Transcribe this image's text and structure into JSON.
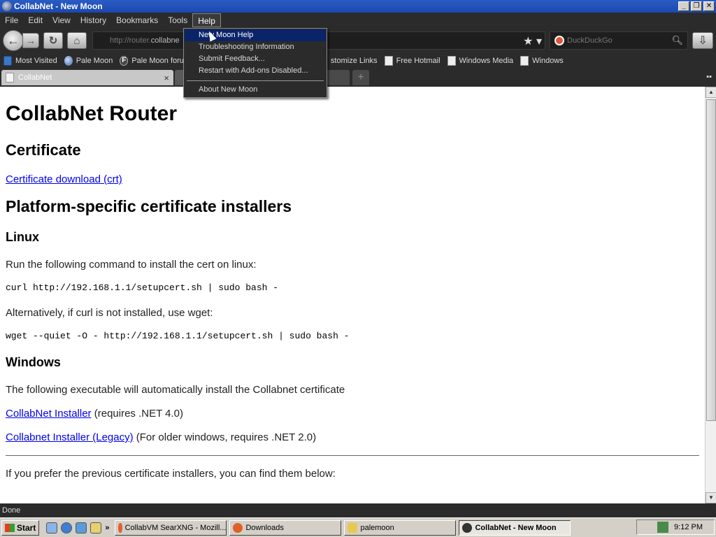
{
  "window": {
    "title": "CollabNet - New Moon"
  },
  "menubar": {
    "items": [
      {
        "label": "File"
      },
      {
        "label": "Edit"
      },
      {
        "label": "View"
      },
      {
        "label": "History"
      },
      {
        "label": "Bookmarks"
      },
      {
        "label": "Tools"
      },
      {
        "label": "Help"
      }
    ]
  },
  "navbar": {
    "url_prefix": "http://router.",
    "url_host": "collabne",
    "search_placeholder": "DuckDuckGo"
  },
  "bookmarks": [
    {
      "label": "Most Visited",
      "icon": "most-visited-icon"
    },
    {
      "label": "Pale Moon",
      "icon": "pale-moon-icon"
    },
    {
      "label": "Pale Moon foru",
      "icon": "pale-moon-forum-icon"
    },
    {
      "label": "stomize Links",
      "icon": "page-icon"
    },
    {
      "label": "Free Hotmail",
      "icon": "page-icon"
    },
    {
      "label": "Windows Media",
      "icon": "page-icon"
    },
    {
      "label": "Windows",
      "icon": "page-icon"
    }
  ],
  "tab": {
    "label": "CollabNet",
    "close": "×"
  },
  "help_menu": {
    "items": [
      {
        "label": "New Moon Help",
        "highlighted": true
      },
      {
        "label": "Troubleshooting Information"
      },
      {
        "label": "Submit Feedback..."
      },
      {
        "label": "Restart with Add-ons Disabled..."
      },
      {
        "label": "About New Moon"
      }
    ]
  },
  "page": {
    "title": "CollabNet Router",
    "cert_heading": "Certificate",
    "cert_link": "Certificate download (crt)",
    "platform_heading": "Platform-specific certificate installers",
    "linux_heading": "Linux",
    "linux_text": "Run the following command to install the cert on linux:",
    "linux_cmd": "curl http://192.168.1.1/setupcert.sh | sudo bash -",
    "linux_alt_text": "Alternatively, if curl is not installed, use wget:",
    "linux_alt_cmd": "wget --quiet -O - http://192.168.1.1/setupcert.sh | sudo bash -",
    "windows_heading": "Windows",
    "windows_text": "The following executable will automatically install the Collabnet certificate",
    "installer_link": "CollabNet Installer",
    "installer_note": " (requires .NET 4.0)",
    "legacy_link": "Collabnet Installer (Legacy)",
    "legacy_note": " (For older windows, requires .NET 2.0)",
    "previous_text": "If you prefer the previous certificate installers, you can find them below:"
  },
  "status": {
    "text": "Done"
  },
  "taskbar": {
    "start_label": "Start",
    "tasks": [
      {
        "label": "CollabVM SearXNG - Mozill...",
        "active": false
      },
      {
        "label": "Downloads",
        "active": false
      },
      {
        "label": "palemoon",
        "active": false
      },
      {
        "label": "CollabNet - New Moon",
        "active": true
      }
    ],
    "clock": "9:12 PM"
  },
  "colors": {
    "link": "#0000ee",
    "menu_highlight": "#0a246a",
    "chrome": "#2b2b2b"
  }
}
